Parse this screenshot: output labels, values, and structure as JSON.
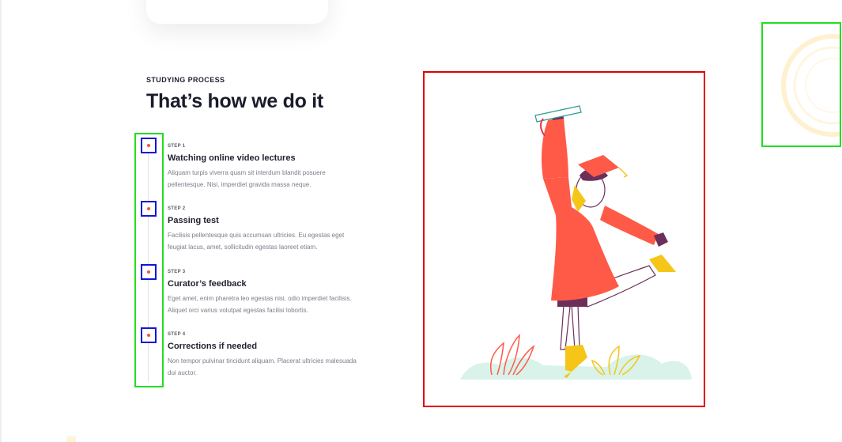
{
  "section": {
    "eyebrow": "STUDYING PROCESS",
    "title": "That’s how we do it"
  },
  "steps": [
    {
      "label": "STEP 1",
      "title": "Watching online video lectures",
      "description": "Aliquam turpis viverra quam sit interdum blandit posuere pellentesque. Nisi, imperdiet gravida massa neque."
    },
    {
      "label": "STEP 2",
      "title": "Passing test",
      "description": "Facilisis pellentesque quis accumsan ultricies. Eu egestas eget feugiat lacus, amet, sollicitudin egestas laoreet etiam."
    },
    {
      "label": "STEP 3",
      "title": "Curator’s feedback",
      "description": "Eget amet, enim pharetra leo egestas nisi, odio imperdiet facilisis. Aliquet orci varius volutpat egestas facilisi lobortis."
    },
    {
      "label": "STEP 4",
      "title": "Corrections if needed",
      "description": "Non tempor pulvinar tincidunt aliquam. Placerat ultricies malesuada dui auctor."
    }
  ],
  "colors": {
    "accent": "#ff5a47",
    "timeline_dot": "#ff4d3d",
    "heading": "#1a1c2b",
    "body_text": "#7b7e8a",
    "illustration_yellow": "#f5c518",
    "illustration_mint": "#d9f3ea",
    "decoration_cream": "#fff1cf"
  },
  "illustration": {
    "icon": "graduate-celebrating-illustration"
  },
  "decoration": {
    "icon": "concentric-circles-decoration"
  }
}
